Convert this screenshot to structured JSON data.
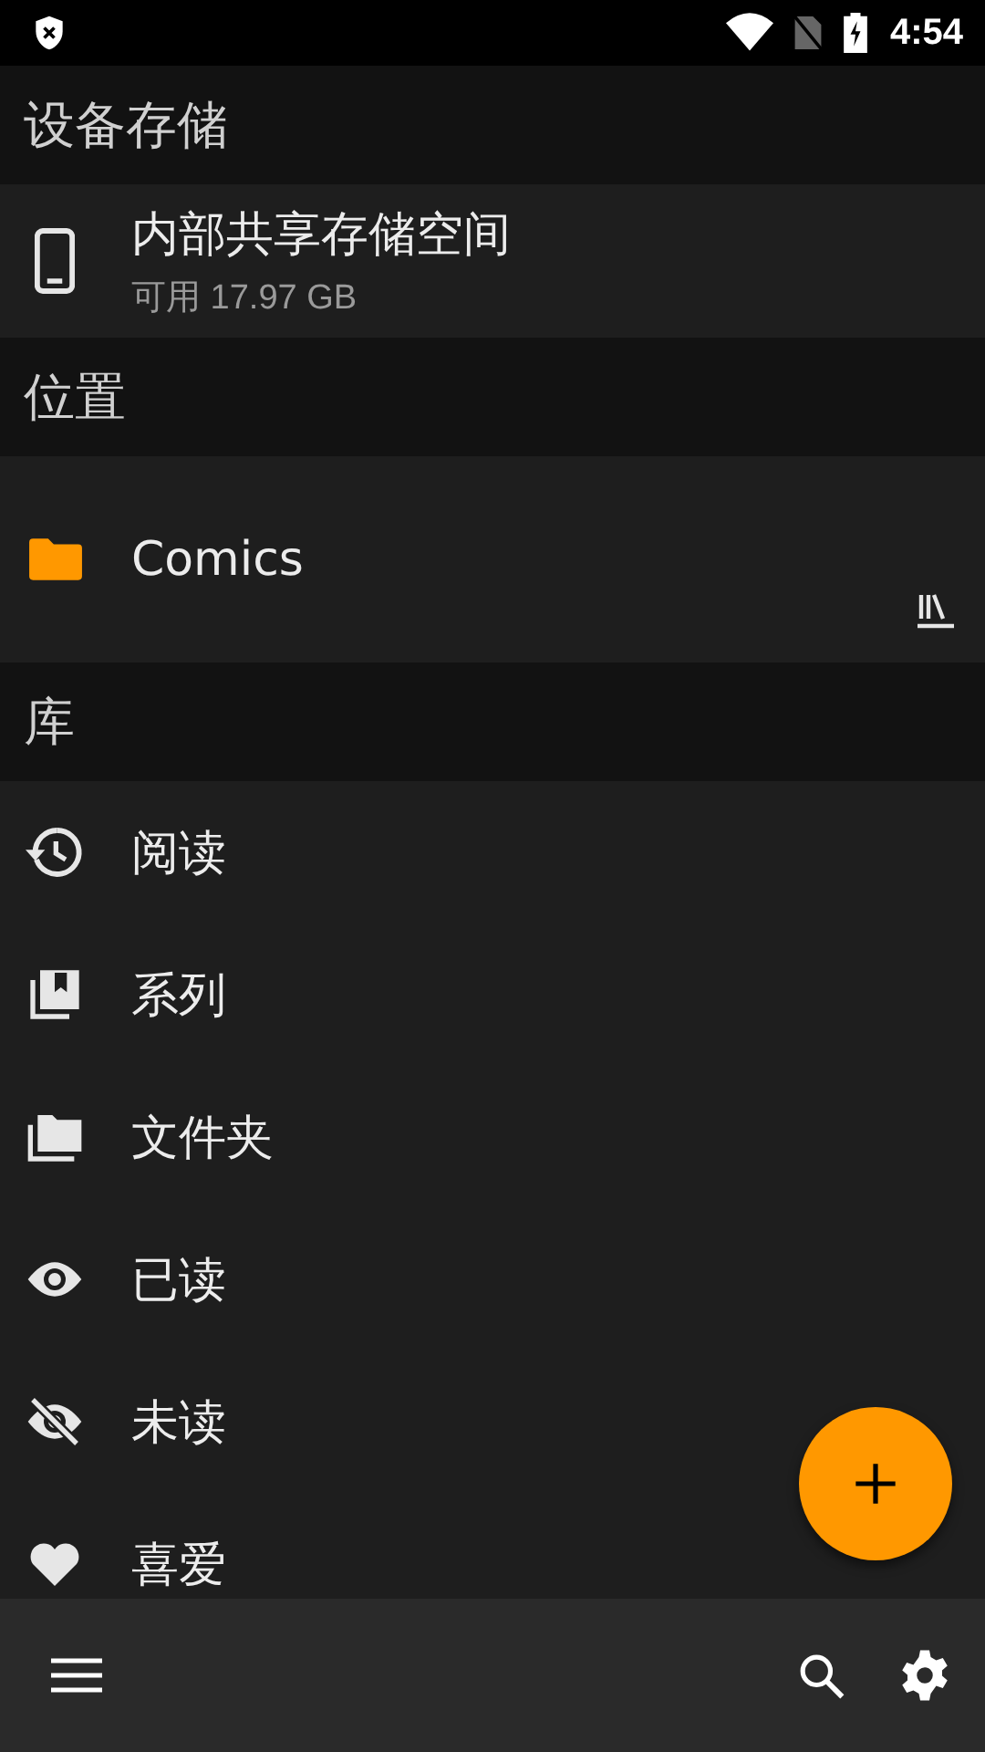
{
  "status_bar": {
    "time": "4:54"
  },
  "sections": [
    {
      "title": "设备存储",
      "kind": "storage",
      "items": [
        {
          "name": "内部共享存储空间",
          "detail": "可用 17.97 GB"
        }
      ]
    },
    {
      "title": "位置",
      "kind": "location",
      "items": [
        {
          "name": "Comics"
        }
      ]
    },
    {
      "title": "库",
      "kind": "library",
      "items": [
        {
          "name": "阅读"
        },
        {
          "name": "系列"
        },
        {
          "name": "文件夹"
        },
        {
          "name": "已读"
        },
        {
          "name": "未读"
        },
        {
          "name": "喜爱"
        }
      ]
    }
  ]
}
